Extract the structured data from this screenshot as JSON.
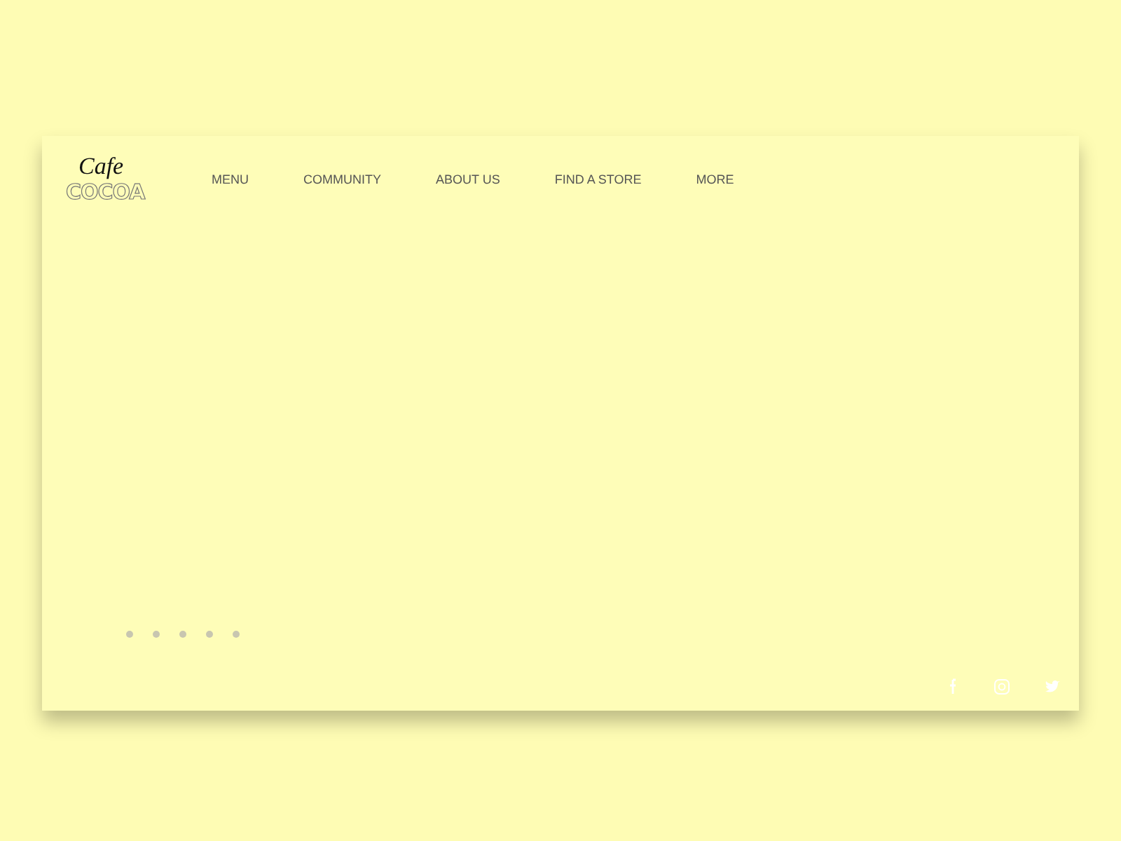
{
  "logo": {
    "script": "Cafe",
    "word": "COCOA"
  },
  "nav": [
    {
      "label": "MENU"
    },
    {
      "label": "COMMUNITY"
    },
    {
      "label": "ABOUT US"
    },
    {
      "label": "FIND A STORE"
    },
    {
      "label": "MORE"
    }
  ],
  "slides": [
    {
      "selected": false
    },
    {
      "selected": false
    },
    {
      "selected": false
    },
    {
      "selected": false
    },
    {
      "selected": false
    }
  ],
  "social": [
    {
      "kind": "facebook"
    },
    {
      "kind": "instagram"
    },
    {
      "kind": "twitter"
    }
  ]
}
